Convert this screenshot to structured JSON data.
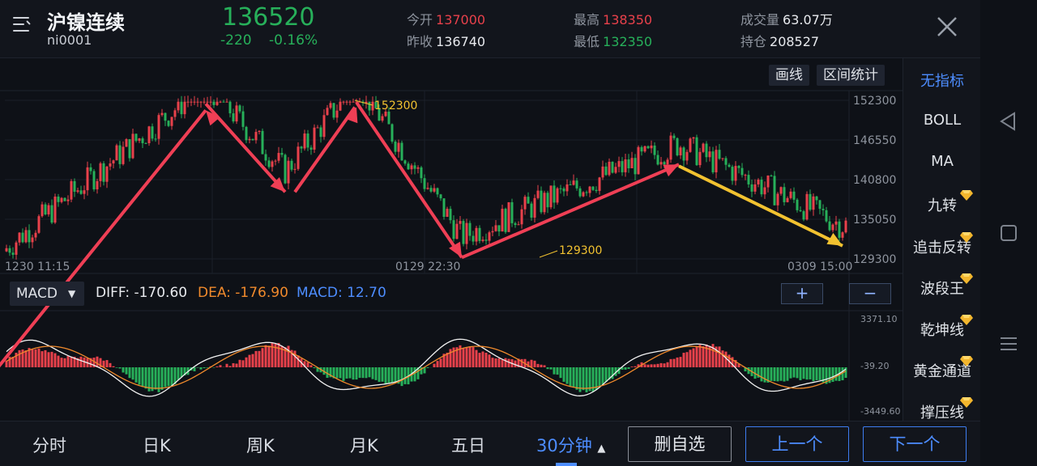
{
  "header": {
    "title": "沪镍连续",
    "code": "ni0001",
    "price": "136520",
    "change": "-220",
    "change_pct": "-0.16%",
    "open_label": "今开",
    "open_value": "137000",
    "prev_close_label": "昨收",
    "prev_close_value": "136740",
    "high_label": "最高",
    "high_value": "138350",
    "low_label": "最低",
    "low_value": "132350",
    "volume_label": "成交量",
    "volume_value": "63.07万",
    "oi_label": "持仓",
    "oi_value": "208527"
  },
  "toolbar": {
    "draw_label": "画线",
    "range_stats_label": "区间统计"
  },
  "indicators": [
    {
      "label": "无指标",
      "active": true,
      "vip": false
    },
    {
      "label": "BOLL",
      "active": false,
      "vip": false
    },
    {
      "label": "MA",
      "active": false,
      "vip": false
    },
    {
      "label": "九转",
      "active": false,
      "vip": true
    },
    {
      "label": "追击反转",
      "active": false,
      "vip": true
    },
    {
      "label": "波段王",
      "active": false,
      "vip": true
    },
    {
      "label": "乾坤线",
      "active": false,
      "vip": true
    },
    {
      "label": "黄金通道",
      "active": false,
      "vip": true
    },
    {
      "label": "撑压线",
      "active": false,
      "vip": true
    }
  ],
  "chart_data": {
    "type": "candlestick",
    "interval": "30分钟",
    "price_axis_labels": [
      "152300",
      "146550",
      "140800",
      "135050",
      "129300"
    ],
    "price_range": [
      129300,
      152300
    ],
    "time_labels": [
      "1230  11:15",
      "0129  22:30",
      "0309  15:00"
    ],
    "annotations": [
      {
        "text": "152300",
        "price": 152300
      },
      {
        "text": "129300",
        "price": 129300
      }
    ],
    "trend_points": [
      {
        "price": 127500
      },
      {
        "price": 151800
      },
      {
        "price": 139000
      },
      {
        "price": 152000
      },
      {
        "price": 129500
      },
      {
        "price": 143000
      },
      {
        "price": 131200
      }
    ],
    "colors": {
      "up": "#e8414b",
      "down": "#27b05a",
      "trend": "#ef3f55",
      "last_trend": "#f2c230"
    }
  },
  "macd": {
    "select_label": "MACD",
    "diff_text": "DIFF: -170.60",
    "dea_text": "DEA: -176.90",
    "macd_text": "MACD: 12.70",
    "axis_labels": [
      "3371.10",
      "-39.20",
      "-3449.60"
    ],
    "zoom_in": "+",
    "zoom_out": "−"
  },
  "bottom": {
    "tabs": [
      "分时",
      "日K",
      "周K",
      "月K",
      "五日",
      "30分钟"
    ],
    "active_tab_arrow": "▲",
    "remove_watch": "删自选",
    "prev": "上一个",
    "next": "下一个"
  }
}
